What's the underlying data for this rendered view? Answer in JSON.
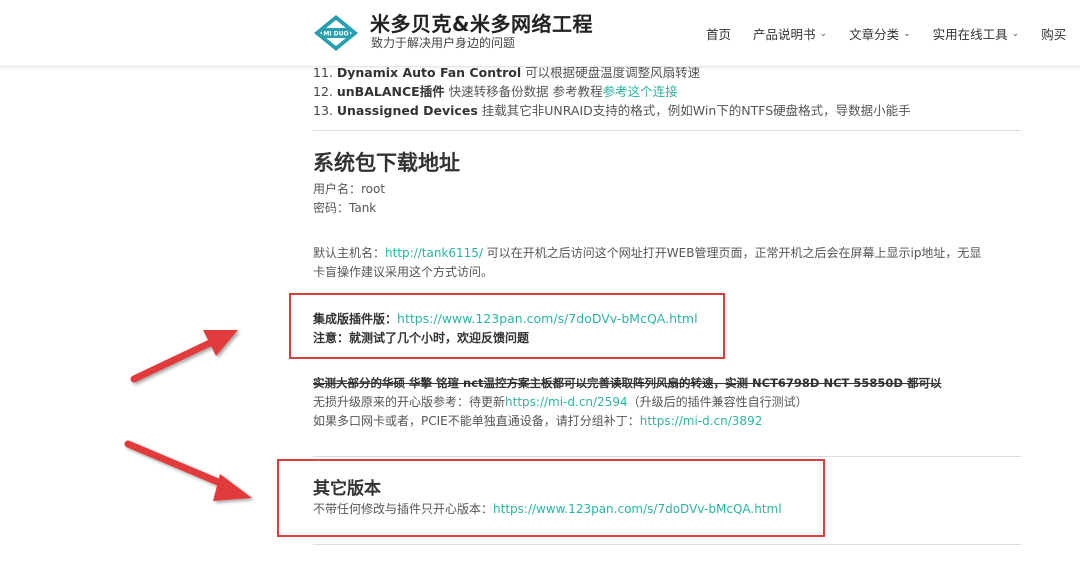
{
  "header": {
    "site_title": "米多贝克&米多网络工程",
    "site_desc": "致力于解决用户身边的问题",
    "logo_text": "MI DUO",
    "nav": [
      {
        "label": "首页",
        "has_dropdown": false
      },
      {
        "label": "产品说明书",
        "has_dropdown": true
      },
      {
        "label": "文章分类",
        "has_dropdown": true
      },
      {
        "label": "实用在线工具",
        "has_dropdown": true
      },
      {
        "label": "购买",
        "has_dropdown": false
      }
    ]
  },
  "list": [
    {
      "num": "11.",
      "bold": "Dynamix Auto Fan Control",
      "text": " 可以根据硬盘温度调整风扇转速",
      "link": ""
    },
    {
      "num": "12.",
      "bold": "unBALANCE插件",
      "text": " 快速转移备份数据 参考教程",
      "link": "参考这个连接"
    },
    {
      "num": "13.",
      "bold": "Unassigned Devices",
      "text": " 挂载其它非UNRAID支持的格式，例如Win下的NTFS硬盘格式，导数据小能手",
      "link": ""
    }
  ],
  "download": {
    "heading": "系统包下载地址",
    "username": "用户名：root",
    "password": "密码：Tank",
    "hostname_prefix": "默认主机名：",
    "hostname_link": "http://tank6115/",
    "hostname_text": " 可以在开机之后访问这个网址打开WEB管理页面，正常开机之后会在屏幕上显示ip地址，无显",
    "hostname_text2": "卡盲操作建议采用这个方式访问。",
    "integrated_label": "集成版插件版：",
    "integrated_link": "https://www.123pan.com/s/7doDVv-bMcQA.html",
    "note": "注意：就测试了几个小时，欢迎反馈问题",
    "strike_text": "实测大部分的华硕 华擎 铭瑄 nct温控方案主板都可以完善读取阵列风扇的转速，实测 NCT6798D NCT 55850D 都可以",
    "upgrade_prefix": "无损升级原来的开心版参考：待更新",
    "upgrade_link": "https://mi-d.cn/2594",
    "upgrade_suffix": "（升级后的插件兼容性自行测试）",
    "patch_prefix": "如果多口网卡或者，PCIE不能单独直通设备，请打分组补丁：",
    "patch_link": "https://mi-d.cn/3892"
  },
  "other": {
    "heading": "其它版本",
    "text_prefix": "不带任何修改与插件只开心版本：",
    "link": "https://www.123pan.com/s/7doDVv-bMcQA.html"
  },
  "colors": {
    "link": "#2bb5a0",
    "annotation_red": "#e23b3b",
    "logo_teal": "#2a9fb0"
  }
}
